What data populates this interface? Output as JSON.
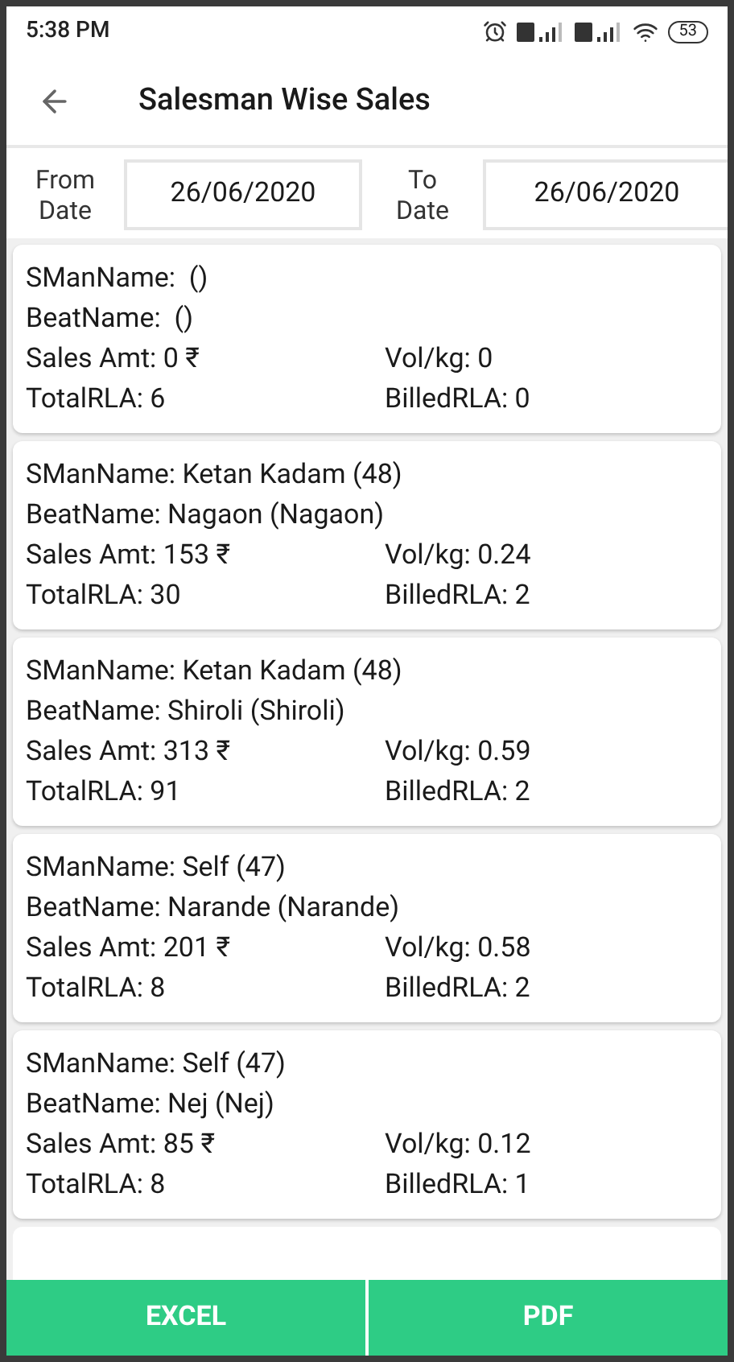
{
  "status_bar": {
    "time": "5:38 PM",
    "battery": "53"
  },
  "header": {
    "title": "Salesman Wise Sales"
  },
  "date_filter": {
    "from_label": "From Date",
    "from_value": "26/06/2020",
    "to_label": "To Date",
    "to_value": "26/06/2020"
  },
  "records": [
    {
      "sman_name": "SManName:  ()",
      "beat_name": "BeatName:  ()",
      "sales_amt": "Sales Amt: 0 ₹",
      "vol": "Vol/kg: 0",
      "total_rla": "TotalRLA: 6",
      "billed_rla": "BilledRLA: 0"
    },
    {
      "sman_name": "SManName: Ketan Kadam (48)",
      "beat_name": "BeatName: Nagaon (Nagaon)",
      "sales_amt": "Sales Amt: 153 ₹",
      "vol": "Vol/kg: 0.24",
      "total_rla": "TotalRLA: 30",
      "billed_rla": "BilledRLA: 2"
    },
    {
      "sman_name": "SManName: Ketan Kadam (48)",
      "beat_name": "BeatName: Shiroli (Shiroli)",
      "sales_amt": "Sales Amt: 313 ₹",
      "vol": "Vol/kg: 0.59",
      "total_rla": "TotalRLA: 91",
      "billed_rla": "BilledRLA: 2"
    },
    {
      "sman_name": "SManName: Self (47)",
      "beat_name": "BeatName: Narande (Narande)",
      "sales_amt": "Sales Amt: 201 ₹",
      "vol": "Vol/kg: 0.58",
      "total_rla": "TotalRLA: 8",
      "billed_rla": "BilledRLA: 2"
    },
    {
      "sman_name": "SManName: Self (47)",
      "beat_name": "BeatName: Nej (Nej)",
      "sales_amt": "Sales Amt: 85 ₹",
      "vol": "Vol/kg: 0.12",
      "total_rla": "TotalRLA: 8",
      "billed_rla": "BilledRLA: 1"
    }
  ],
  "buttons": [
    "EXCEL",
    "PDF"
  ]
}
